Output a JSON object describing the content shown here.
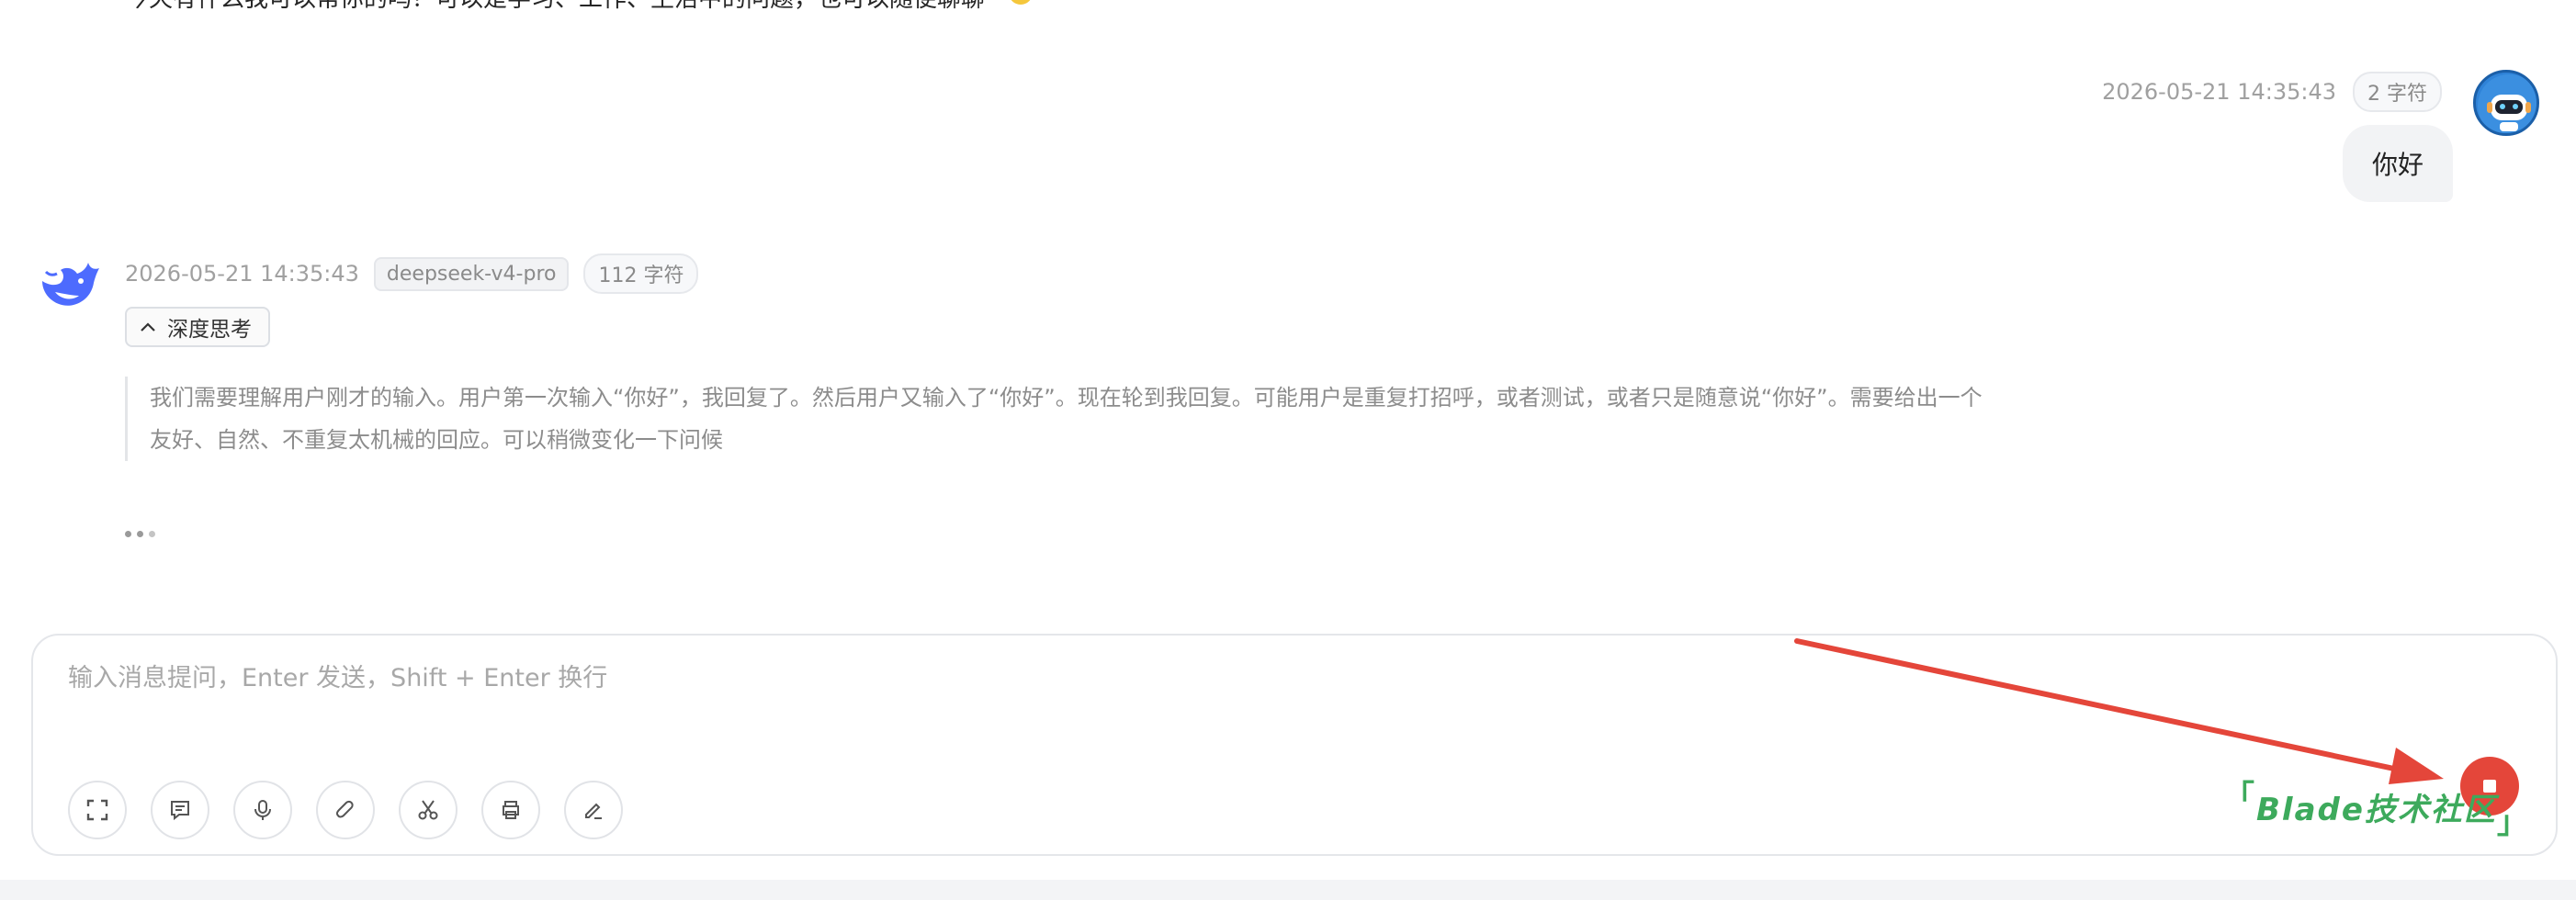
{
  "previous_message": {
    "text": "今天有什么我可以帮你的吗？可以是学习、工作、生活中的问题，也可以随便聊聊",
    "emoji": "smiling-face-emoji"
  },
  "user_message": {
    "timestamp": "2026-05-21 14:35:43",
    "char_count": "2 字符",
    "text": "你好",
    "avatar": "robot-avatar"
  },
  "assistant_message": {
    "avatar": "deepseek-whale-logo",
    "timestamp": "2026-05-21 14:35:43",
    "model": "deepseek-v4-pro",
    "char_count": "112 字符",
    "think_toggle_label": "深度思考",
    "think_lines": [
      "我们需要理解用户刚才的输入。用户第一次输入“你好”，我回复了。然后用户又输入了“你好”。现在轮到我回复。可能用户是重复打招呼，或者测试，或者只是随意说“你好”。需要给出一个",
      "友好、自然、不重复太机械的回应。可以稍微变化一下问候"
    ],
    "loading_indicator": "typing-dots"
  },
  "composer": {
    "placeholder": "输入消息提问，Enter 发送，Shift + Enter 换行",
    "value": "",
    "tools": [
      "fullscreen-icon",
      "chat-icon",
      "microphone-icon",
      "paperclip-icon",
      "scissors-icon",
      "printer-icon",
      "eraser-pen-icon"
    ],
    "stop_button": "stop-icon"
  },
  "watermark": {
    "text": "Blade技术社区",
    "open_bracket": "「",
    "close_bracket": "」"
  },
  "colors": {
    "accent_red": "#e4463a",
    "watermark_green": "#3daa5c",
    "whale_blue": "#4d6bfe",
    "avatar_blue": "#2f83d8"
  }
}
